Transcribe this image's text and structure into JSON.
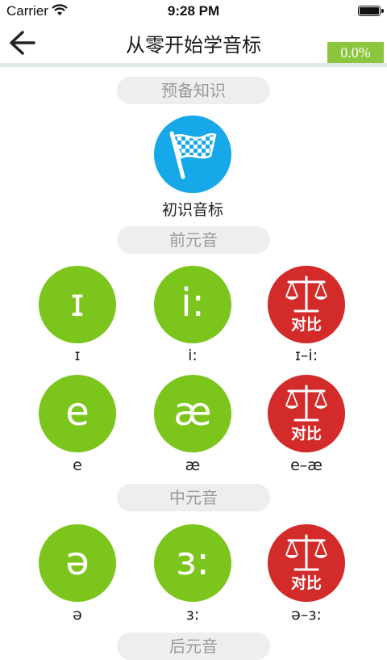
{
  "status": {
    "carrier": "Carrier",
    "time": "9:28 PM"
  },
  "nav": {
    "title": "从零开始学音标",
    "progress": "0.0%"
  },
  "sections": {
    "prep": "预备知识",
    "front": "前元音",
    "central": "中元音",
    "back": "后元音"
  },
  "intro": {
    "label": "初识音标"
  },
  "compare_text": "对比",
  "rows": [
    {
      "a": {
        "sym": "ɪ",
        "label": "ɪ"
      },
      "b": {
        "sym": "i:",
        "label": "i:"
      },
      "c": {
        "label": "ɪ–i:"
      }
    },
    {
      "a": {
        "sym": "e",
        "label": "e"
      },
      "b": {
        "sym": "æ",
        "label": "æ"
      },
      "c": {
        "label": "e–æ"
      }
    },
    {
      "a": {
        "sym": "ə",
        "label": "ə"
      },
      "b": {
        "sym": "ɜ:",
        "label": "ɜ:"
      },
      "c": {
        "label": "ə–ɜ:"
      }
    }
  ],
  "colors": {
    "green": "#7cc51d",
    "blue": "#16a8e8",
    "red": "#d32a2a",
    "progress": "#8cc63f"
  }
}
